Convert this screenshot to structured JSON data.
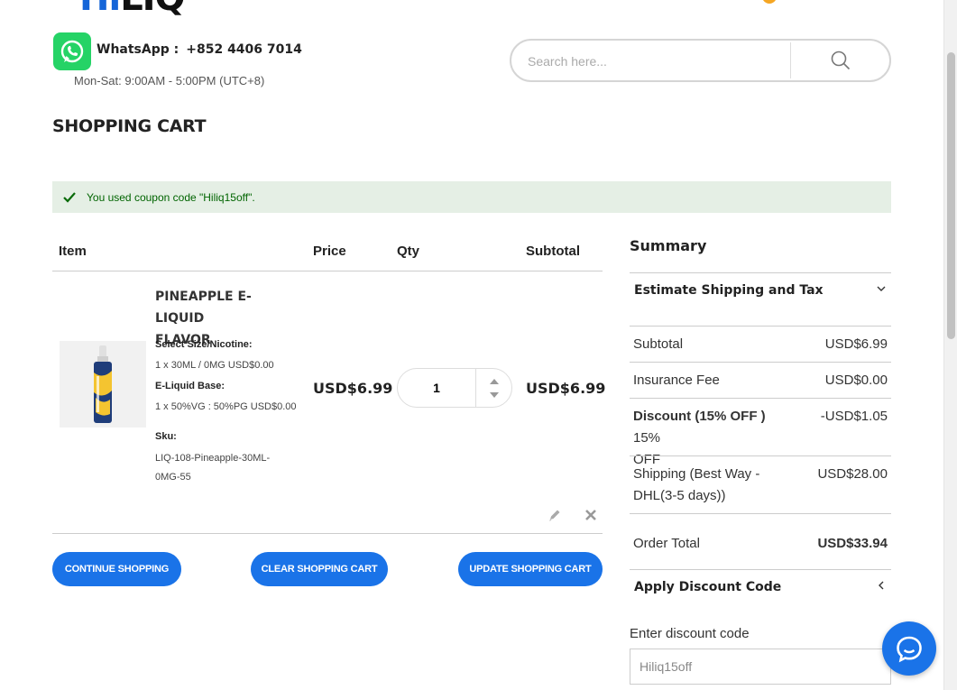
{
  "header": {
    "logo_hi": "Hi",
    "logo_liq": "LIQ",
    "whatsapp_label": "WhatsApp :",
    "whatsapp_number": "+852 4406 7014",
    "hours": "Mon-Sat: 9:00AM - 5:00PM (UTC+8)",
    "search_placeholder": "Search here..."
  },
  "page_title": "SHOPPING CART",
  "notice": "You used coupon code \"Hiliq15off\".",
  "table": {
    "headers": {
      "item": "Item",
      "price": "Price",
      "qty": "Qty",
      "subtotal": "Subtotal"
    },
    "items": [
      {
        "name_line1": "PINEAPPLE E-LIQUID",
        "name_line2": "FLAVOR",
        "opt1_label": "Select Size/Nicotine:",
        "opt1_value": "1 x 30ML / 0MG USD$0.00",
        "opt2_label": "E-Liquid Base:",
        "opt2_value": "1 x 50%VG : 50%PG USD$0.00",
        "sku_label": "Sku:",
        "sku_line1": "LIQ-108-Pineapple-30ML-",
        "sku_line2": "0MG-55",
        "price": "USD$6.99",
        "qty": "1",
        "subtotal": "USD$6.99"
      }
    ]
  },
  "buttons": {
    "continue": "CONTINUE SHOPPING",
    "clear": "CLEAR SHOPPING CART",
    "update": "UPDATE SHOPPING CART"
  },
  "summary": {
    "title": "Summary",
    "estimate": "Estimate Shipping and Tax",
    "rows": {
      "subtotal_label": "Subtotal",
      "subtotal_value": "USD$6.99",
      "insurance_label": "Insurance Fee",
      "insurance_value": "USD$0.00",
      "discount_label_bold": "Discount (15% OFF )",
      "discount_label_rest": " 15%",
      "discount_label_line2": "OFF",
      "discount_value": "-USD$1.05",
      "shipping_line1": "Shipping (Best Way -",
      "shipping_line2": "DHL(3-5 days))",
      "shipping_value": "USD$28.00",
      "total_label": "Order Total",
      "total_value": "USD$33.94"
    },
    "apply_discount": "Apply Discount Code",
    "discount_field_label": "Enter discount code",
    "discount_field_value": "Hiliq15off"
  },
  "colors": {
    "accent": "#1a73e8",
    "notice_bg": "#e5efe5",
    "notice_text": "#006400",
    "whatsapp": "#25d366"
  }
}
